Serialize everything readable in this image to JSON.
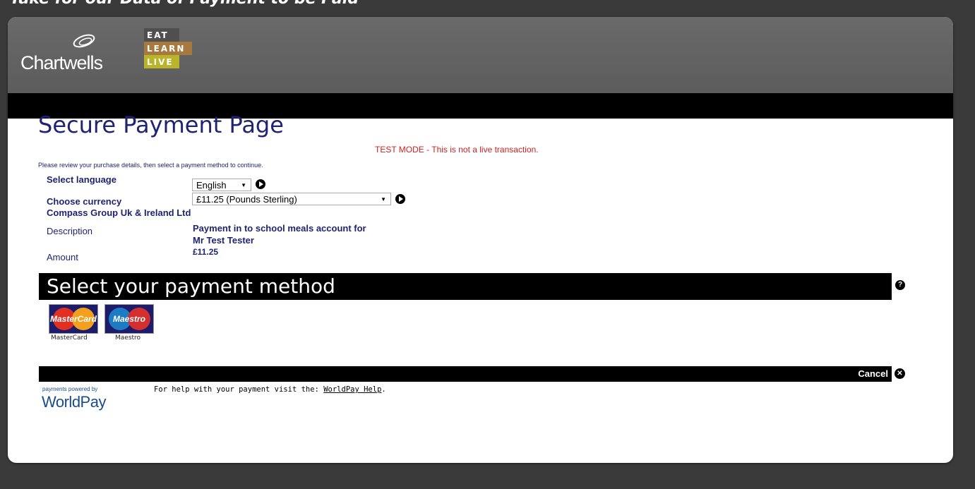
{
  "page": {
    "cutoff_text": "Take for our Data of Payment to be Paid"
  },
  "header": {
    "brand": "Chartwells",
    "tagline": [
      "EAT",
      "LEARN",
      "LIVE"
    ]
  },
  "main": {
    "title": "Secure Payment Page",
    "test_mode": "TEST MODE - This is not a live transaction.",
    "intro": "Please review your purchase details, then select a payment method to continue.",
    "language_label": "Select language",
    "language_value": "English",
    "currency_label": "Choose currency",
    "currency_value": "£11.25 (Pounds Sterling)",
    "merchant": "Compass Group Uk & Ireland Ltd",
    "description_label": "Description",
    "description_line1": "Payment in to school meals account for",
    "description_line2": "Mr Test Tester",
    "amount_label": "Amount",
    "amount_value": "£11.25"
  },
  "payment_methods": {
    "title": "Select your payment method",
    "items": [
      {
        "label": "MasterCard",
        "logo_text": "MasterCard"
      },
      {
        "label": "Maestro",
        "logo_text": "Maestro"
      }
    ]
  },
  "footer": {
    "cancel_label": "Cancel",
    "powered_by": "payments powered by",
    "worldpay": "WorldPay",
    "help_text": "For help with your payment visit the: ",
    "help_link": "WorldPay Help",
    "help_suffix": "."
  },
  "colors": {
    "navy": "#1f2373",
    "test_red": "#cc2222",
    "header_gray": "#5c5c5c"
  }
}
